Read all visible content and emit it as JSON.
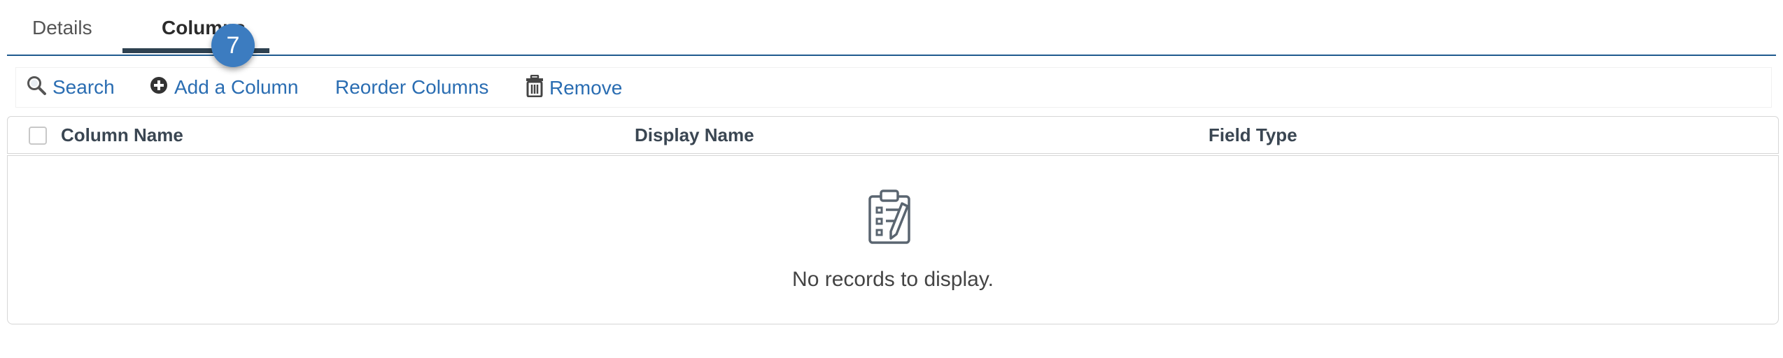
{
  "tabs": {
    "details_label": "Details",
    "columns_label": "Columns",
    "step_badge": "7"
  },
  "toolbar": {
    "search_label": "Search",
    "add_label": "Add a Column",
    "reorder_label": "Reorder Columns",
    "remove_label": "Remove",
    "icons": [
      "magnifier-icon",
      "plus-circle-icon",
      "trash-icon"
    ],
    "link_color": "#2a6db2"
  },
  "grid": {
    "columns": [
      "Column Name",
      "Display Name",
      "Field Type"
    ],
    "empty_message": "No records to display.",
    "empty_icon": "clipboard-checklist-icon"
  },
  "colors": {
    "accent": "#1f5a8e",
    "badge": "#3c7cc0",
    "active_tab_underline": "#2e4150"
  }
}
